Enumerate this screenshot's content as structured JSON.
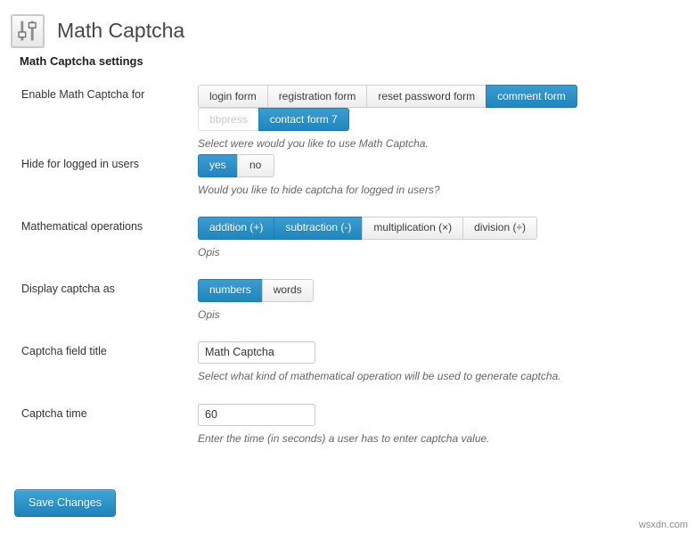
{
  "header": {
    "icon": "sliders-settings-icon",
    "title": "Math Captcha"
  },
  "section": {
    "heading": "Math Captcha settings"
  },
  "colors": {
    "accent": "#1f86bd",
    "accent_light": "#3c9cd0",
    "button_face": "#ededed",
    "text": "#333333",
    "description": "#666666",
    "disabled_text": "#c9c9c9"
  },
  "rows": [
    {
      "label": "Enable Math Captcha for",
      "description": "Select were would you like to use Math Captcha.",
      "control": "buttonset",
      "options_row1": [
        {
          "label": "login form",
          "state": "inactive"
        },
        {
          "label": "registration form",
          "state": "inactive"
        },
        {
          "label": "reset password form",
          "state": "inactive"
        },
        {
          "label": "comment form",
          "state": "active"
        }
      ],
      "options_row2": [
        {
          "label": "bbpress",
          "state": "disabled"
        },
        {
          "label": "contact form 7",
          "state": "active"
        }
      ]
    },
    {
      "label": "Hide for logged in users",
      "description": "Would you like to hide captcha for logged in users?",
      "control": "buttonset",
      "options_row1": [
        {
          "label": "yes",
          "state": "active"
        },
        {
          "label": "no",
          "state": "inactive"
        }
      ]
    },
    {
      "label": "Mathematical operations",
      "description": "Opis",
      "control": "buttonset",
      "options_row1": [
        {
          "label": "addition (+)",
          "state": "active"
        },
        {
          "label": "subtraction (-)",
          "state": "active"
        },
        {
          "label": "multiplication (×)",
          "state": "inactive"
        },
        {
          "label": "division (÷)",
          "state": "inactive"
        }
      ]
    },
    {
      "label": "Display captcha as",
      "description": "Opis",
      "control": "buttonset",
      "options_row1": [
        {
          "label": "numbers",
          "state": "active"
        },
        {
          "label": "words",
          "state": "inactive"
        }
      ]
    },
    {
      "label": "Captcha field title",
      "description": "Select what kind of mathematical operation will be used to generate captcha.",
      "control": "text",
      "value": "Math Captcha",
      "placeholder": ""
    },
    {
      "label": "Captcha time",
      "description": "Enter the time (in seconds) a user has to enter captcha value.",
      "control": "text",
      "value": "60",
      "placeholder": ""
    }
  ],
  "footer": {
    "save_label": "Save Changes",
    "watermark": "wsxdn.com"
  }
}
